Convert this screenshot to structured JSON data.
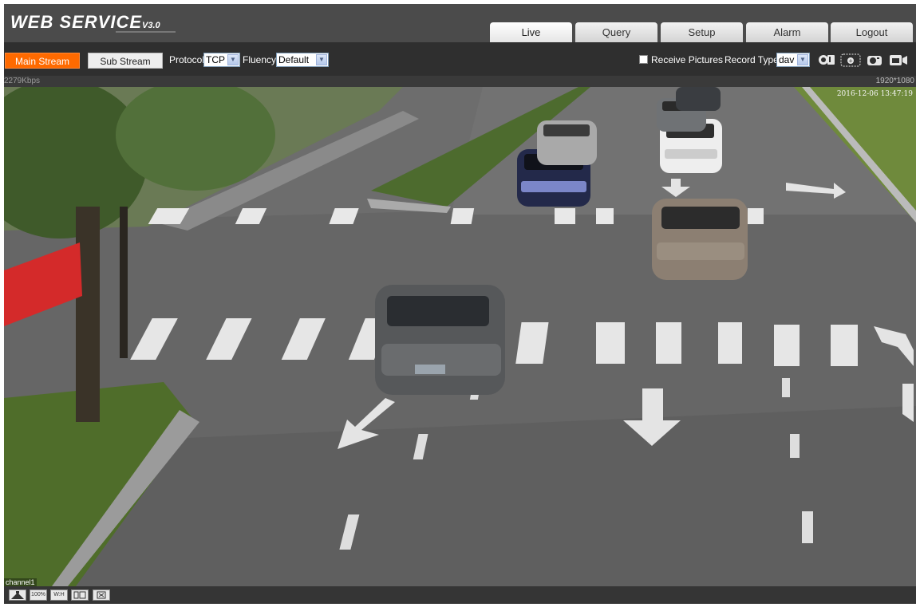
{
  "header": {
    "logo": "WEB  SERVICE",
    "logo_version": "V3.0",
    "tabs": [
      {
        "label": "Live",
        "active": true
      },
      {
        "label": "Query",
        "active": false
      },
      {
        "label": "Setup",
        "active": false
      },
      {
        "label": "Alarm",
        "active": false
      },
      {
        "label": "Logout",
        "active": false
      }
    ]
  },
  "toolbar": {
    "main_stream_label": "Main Stream",
    "sub_stream_label": "Sub Stream",
    "protocol_label": "Protocol",
    "protocol_value": "TCP",
    "fluency_label": "Fluency",
    "fluency_value": "Default",
    "receive_pictures_label": "Receive Pictures",
    "receive_pictures_checked": false,
    "record_type_label": "Record Type",
    "record_type_value": "dav",
    "tool_icons": [
      "manual-control-icon",
      "zoom-icon",
      "snapshot-icon",
      "record-icon"
    ]
  },
  "video": {
    "bitrate": "2279Kbps",
    "resolution": "1920*1080",
    "timestamp": "2016-12-06 13:47:19",
    "channel_label": "channel1"
  },
  "bottom_bar": {
    "zoom_label": "100%",
    "ratio_label": "W:H",
    "icons": [
      "adjust-icon",
      "original-size-icon",
      "aspect-ratio-icon",
      "window-icon",
      "fullscreen-icon"
    ]
  },
  "colors": {
    "accent": "#ff6a00",
    "header_bg": "#4b4b4b",
    "toolbar_bg": "#2f2f2f",
    "banner_red": "#d42a2a"
  }
}
